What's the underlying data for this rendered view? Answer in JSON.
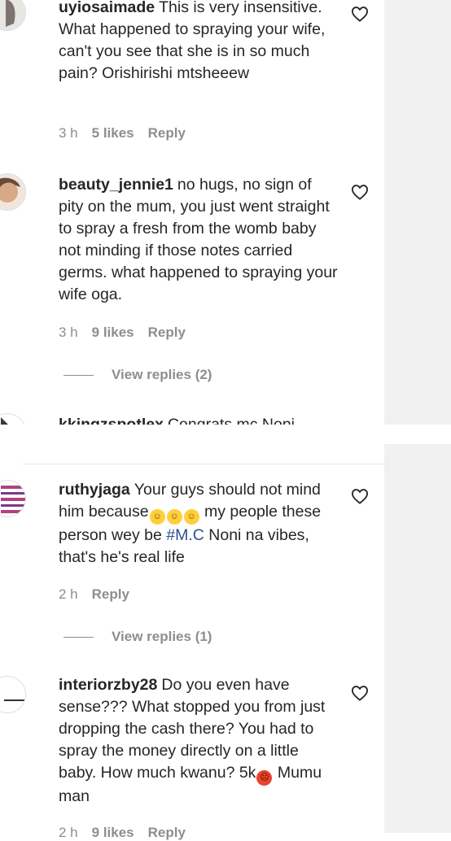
{
  "comments": [
    {
      "username": "uyiosaimade",
      "text": "This is very insensitive. What happened to spraying your wife, can't you see that she is in so much pain? Orishirishi mtsheeew",
      "time": "3 h",
      "likes": "5 likes",
      "reply": "Reply"
    },
    {
      "username": "beauty_jennie1",
      "text": "no hugs, no sign of pity on the mum, you just went straight to spray a fresh from the womb baby not minding if those notes carried germs. what happened to spraying your wife oga.",
      "time": "3 h",
      "likes": "9 likes",
      "reply": "Reply",
      "view_replies": "View replies (2)"
    },
    {
      "username": "kkingzspotlex",
      "text": "Congrats mc Noni"
    },
    {
      "username": "ruthyjaga",
      "text_before_emoji": "Your guys should not mind him because",
      "emoji": [
        "😂",
        "😂",
        "😂"
      ],
      "text_after_emoji": " my people these person wey be ",
      "hashtag": "#M.C",
      "text_end": " Noni na vibes, that's he's real life",
      "time": "2 h",
      "reply": "Reply",
      "view_replies": "View replies (1)"
    },
    {
      "username": "interiorzby28",
      "text_before_emoji": "Do you even have sense??? What stopped you from just dropping the cash there? You had to spray the money directly on a little baby. How much kwanu? 5k",
      "emoji": [
        "😡"
      ],
      "text_end": " Mumu man",
      "time": "2 h",
      "likes": "9 likes",
      "reply": "Reply"
    }
  ],
  "icons": {
    "heart": "heart-outline-icon",
    "avatar": "avatar"
  },
  "colors": {
    "text": "#262626",
    "meta": "#8e8e8e",
    "hashtag": "#2b4f8f",
    "side_panel": "#f1f1f1"
  }
}
